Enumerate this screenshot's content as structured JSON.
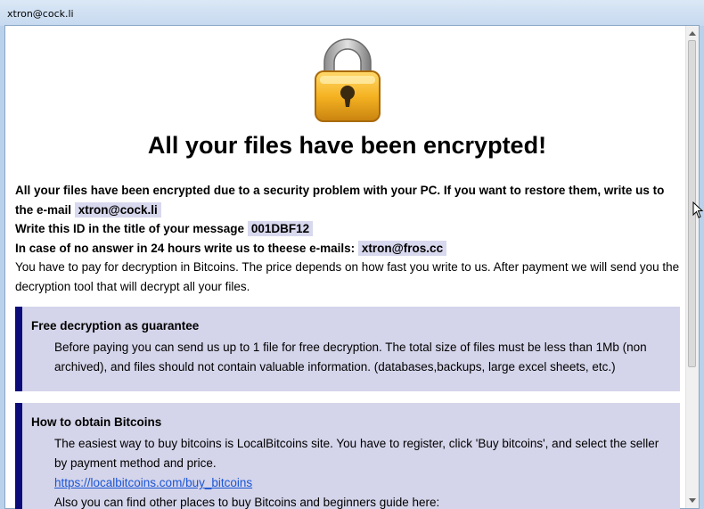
{
  "window": {
    "title": "xtron@cock.li"
  },
  "header": {
    "headline": "All your files have been encrypted!"
  },
  "notice": {
    "line1_text": "All your files have been encrypted due to a security problem with your PC. If you want to restore them, write us to the e-mail",
    "email": "xtron@cock.li",
    "line2_text": "Write this ID in the title of your message",
    "id": "001DBF12",
    "line3_text": "In case of no answer in 24 hours write us to theese e-mails:",
    "backup_email": "xtron@fros.cc",
    "payment_text": "You have to pay for decryption in Bitcoins. The price depends on how fast you write to us. After payment we will send you the decryption tool that will decrypt all your files."
  },
  "sections": [
    {
      "title": "Free decryption as guarantee",
      "body": "Before paying you can send us up to 1 file for free decryption. The total size of files must be less than 1Mb (non archived), and files should not contain valuable information. (databases,backups, large excel sheets, etc.)"
    },
    {
      "title": "How to obtain Bitcoins",
      "body": "The easiest way to buy bitcoins is LocalBitcoins site. You have to register, click 'Buy bitcoins', and select the seller by payment method and price.",
      "link": "https://localbitcoins.com/buy_bitcoins",
      "more": "Also you can find other places to buy Bitcoins and beginners guide here:"
    }
  ],
  "icons": {
    "lock": "padlock-icon"
  },
  "colors": {
    "highlight": "#d8d8ee",
    "box_bg": "#d4d4ea",
    "box_border": "#0b0b7a",
    "link": "#1a56d6"
  }
}
